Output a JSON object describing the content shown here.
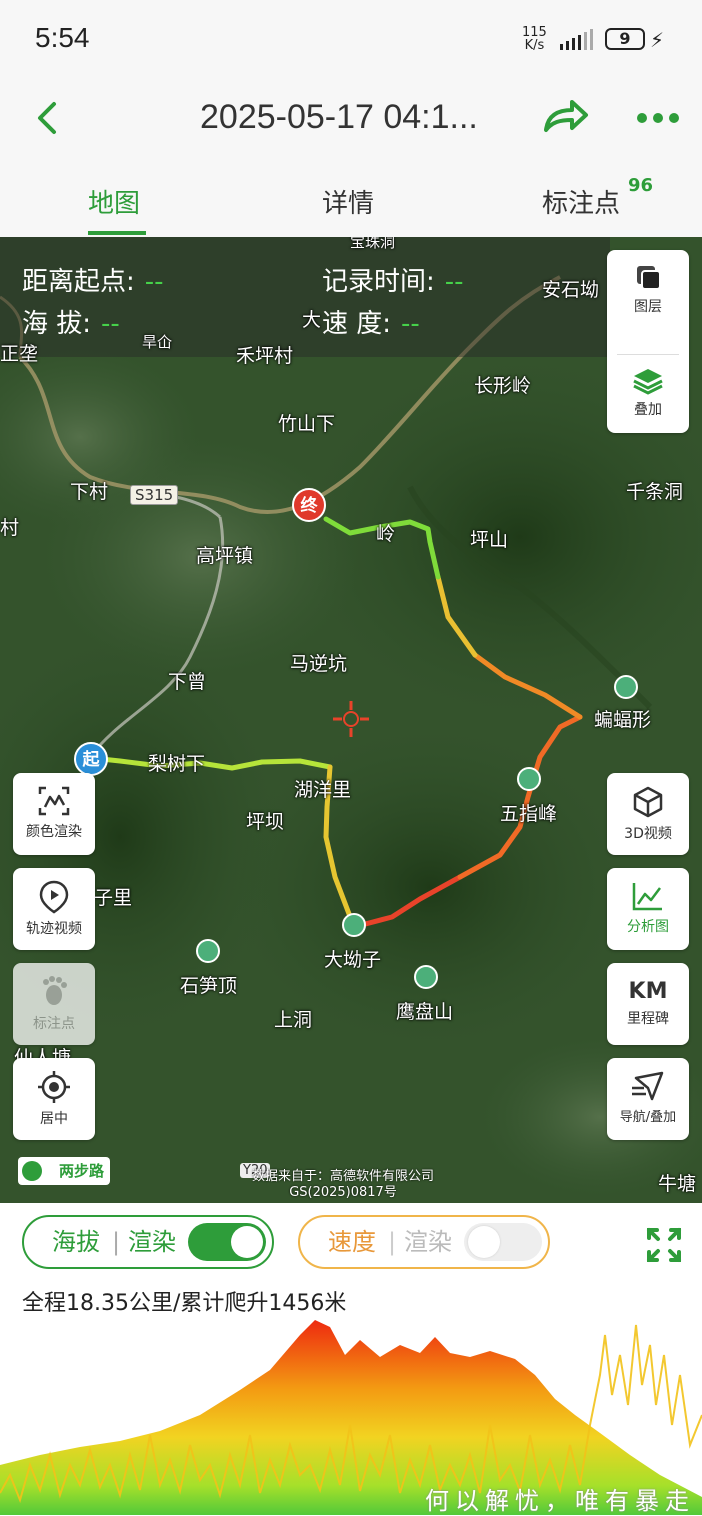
{
  "status_bar": {
    "time": "5:54",
    "net_speed_value": "115",
    "net_speed_unit": "K/s",
    "battery": "9"
  },
  "header": {
    "title": "2025-05-17 04:1..."
  },
  "tabs": [
    {
      "label": "地图",
      "active": true
    },
    {
      "label": "详情",
      "active": false
    },
    {
      "label": "标注点",
      "badge": "96",
      "active": false
    }
  ],
  "info_panel": {
    "distance_label": "距离起点:",
    "distance_value": "--",
    "time_label": "记录时间:",
    "time_value": "--",
    "altitude_label": "海 拔:",
    "altitude_value": "--",
    "speed_label": "速 度:",
    "speed_value": "--"
  },
  "map_places": [
    "宝珠洞",
    "安石坳",
    "正垄",
    "旱仚",
    "禾坪村",
    "长形岭",
    "竹山下",
    "下村",
    "S315",
    "千条洞",
    "村",
    "高坪镇",
    "坪山",
    "马逆坑",
    "下曾",
    "蝙蝠形",
    "梨树下",
    "湖洋里",
    "五指峰",
    "坪坝",
    "子里",
    "大坳子",
    "石笋顶",
    "鹰盘山",
    "上洞",
    "仙人塘",
    "牛塘",
    "大",
    "岭"
  ],
  "markers": {
    "start": "起",
    "end": "终"
  },
  "right_buttons": [
    {
      "label": "图层",
      "icon": "layers-icon"
    },
    {
      "label": "叠加",
      "icon": "stack-icon"
    },
    {
      "label": "3D视频",
      "icon": "cube-icon"
    },
    {
      "label": "分析图",
      "icon": "chart-icon"
    },
    {
      "label": "里程碑",
      "icon": "km-icon",
      "icon_text": "KM"
    },
    {
      "label": "导航/叠加",
      "icon": "navigation-icon"
    }
  ],
  "left_buttons": [
    {
      "label": "颜色渲染",
      "icon": "color-render-icon"
    },
    {
      "label": "轨迹视频",
      "icon": "track-video-icon"
    },
    {
      "label": "标注点",
      "icon": "footprint-icon"
    },
    {
      "label": "居中",
      "icon": "locate-icon"
    }
  ],
  "map_brand": "两步路",
  "attribution": {
    "line1": "数据来自于：高德软件有限公司",
    "line2": "GS(2025)0817号",
    "tag": "Y20"
  },
  "render_controls": {
    "altitude_toggle": {
      "label_a": "海拔",
      "label_b": "渲染",
      "on": true
    },
    "speed_toggle": {
      "label_a": "速度",
      "label_b": "渲染",
      "on": false
    }
  },
  "summary": "全程18.35公里/累计爬升1456米",
  "watermark": "何以解忧，唯有暴走",
  "colors": {
    "accent": "#2e9d3a",
    "speed_accent": "#f0b54a",
    "end_marker": "#e0392b",
    "start_marker": "#2a8fd8"
  }
}
